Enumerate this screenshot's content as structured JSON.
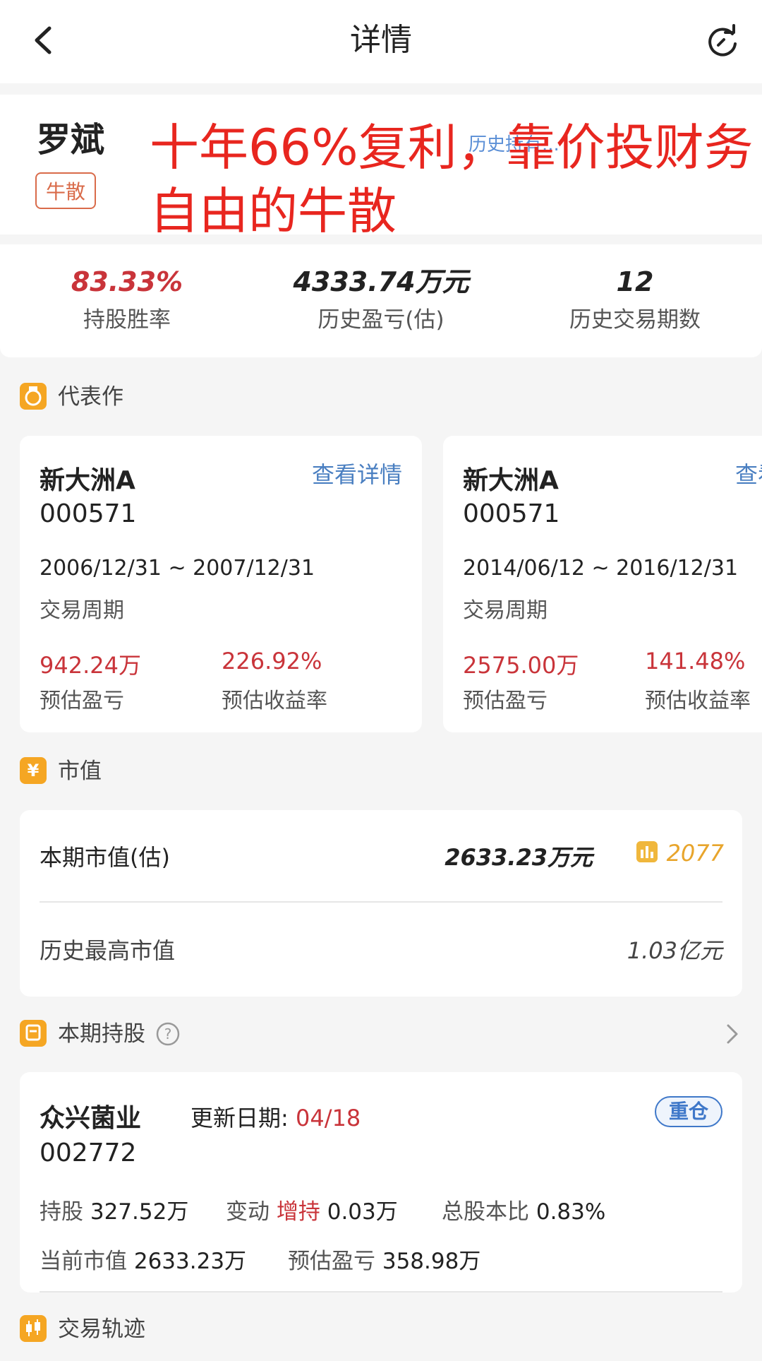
{
  "header": {
    "title": "详情"
  },
  "profile": {
    "name": "罗斌",
    "tag": "牛散",
    "overlay_text": "十年66%复利，靠价投财务自由的牛散",
    "partial_desc": "历史持有..."
  },
  "stats": [
    {
      "value": "83.33%",
      "label": "持股胜率",
      "color": "#c9343a"
    },
    {
      "value": "4333.74万元",
      "label": "历史盈亏(估)",
      "color": "#222222"
    },
    {
      "value": "12",
      "label": "历史交易期数",
      "color": "#222222"
    }
  ],
  "sections": {
    "works": "代表作",
    "market": "市值",
    "holdings": "本期持股",
    "trace": "交易轨迹"
  },
  "works": [
    {
      "name": "新大洲A",
      "code": "000571",
      "link": "查看详情",
      "period": "2006/12/31 ~ 2007/12/31",
      "period_label": "交易周期",
      "profit": "942.24万",
      "profit_label": "预估盈亏",
      "yield": "226.92%",
      "yield_label": "预估收益率"
    },
    {
      "name": "新大洲A",
      "code": "000571",
      "link": "查看详情",
      "period": "2014/06/12 ~ 2016/12/31",
      "period_label": "交易周期",
      "profit": "2575.00万",
      "profit_label": "预估盈亏",
      "yield": "141.48%",
      "yield_label": "预估收益率"
    }
  ],
  "market": {
    "current_label": "本期市值(估)",
    "current_value": "2633.23万元",
    "rank": "2077",
    "max_label": "历史最高市值",
    "max_value": "1.03亿元"
  },
  "holding": {
    "name": "众兴菌业",
    "code": "002772",
    "date_label": "更新日期:",
    "date": "04/18",
    "badge": "重仓",
    "shares_label": "持股",
    "shares": "327.52万",
    "change_label": "变动",
    "change_type": "增持",
    "change": "0.03万",
    "ratio_label": "总股本比",
    "ratio": "0.83%",
    "mv_label": "当前市值",
    "mv": "2633.23万",
    "pl_label": "预估盈亏",
    "pl": "358.98万"
  }
}
